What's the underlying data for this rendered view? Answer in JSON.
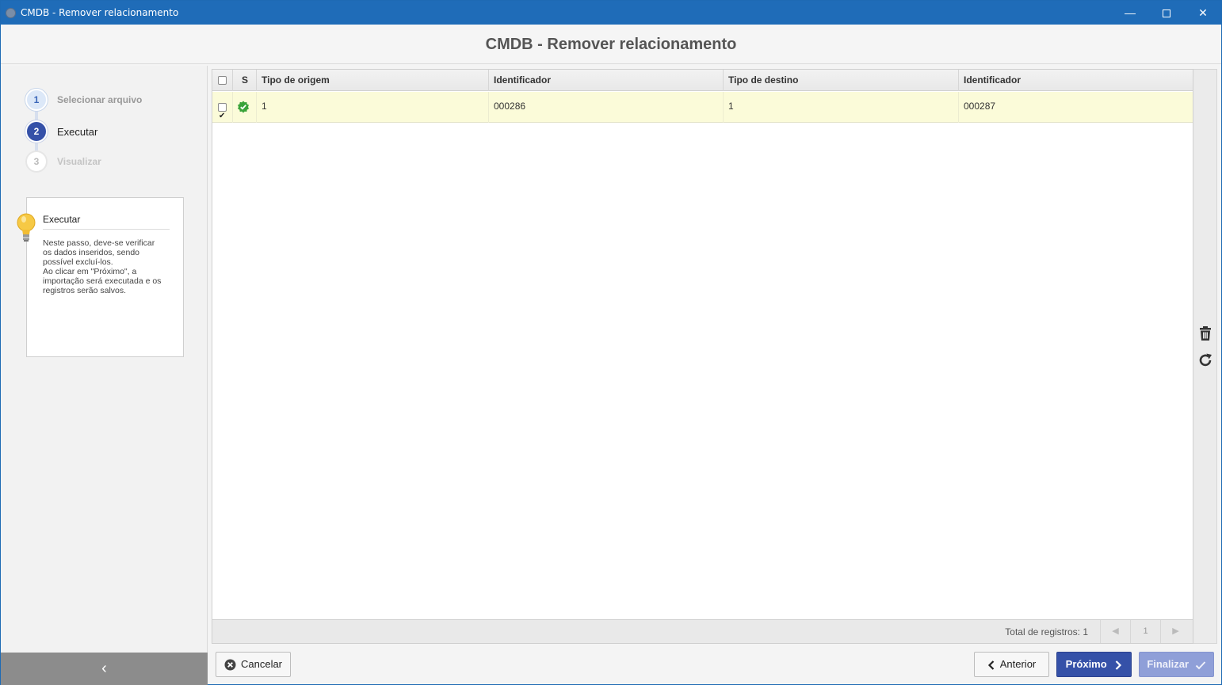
{
  "window": {
    "title": "CMDB - Remover relacionamento",
    "minimize": "—",
    "close": "✕"
  },
  "header": {
    "title": "CMDB - Remover relacionamento"
  },
  "steps": [
    {
      "num": "1",
      "label": "Selecionar arquivo"
    },
    {
      "num": "2",
      "label": "Executar"
    },
    {
      "num": "3",
      "label": "Visualizar"
    }
  ],
  "help": {
    "title": "Executar",
    "text": "Neste passo, deve-se verificar\nos dados inseridos, sendo\npossível excluí-los.\nAo clicar em \"Próximo\", a\nimportação será executada e os\nregistros serão salvos."
  },
  "grid": {
    "columns": [
      "S",
      "Tipo de origem",
      "Identificador",
      "Tipo de destino",
      "Identificador"
    ],
    "rows": [
      {
        "checked": true,
        "status": "ok",
        "tipo_origem": "1",
        "id_origem": "000286",
        "tipo_destino": "1",
        "id_destino": "000287"
      }
    ],
    "total_label": "Total de registros: 1",
    "page": "1",
    "prev_page": "◀",
    "next_page": "▶"
  },
  "buttons": {
    "cancel": "Cancelar",
    "previous": "Anterior",
    "next": "Próximo",
    "finish": "Finalizar"
  },
  "colors": {
    "titlebar": "#1f6cb8",
    "primary": "#3551a8",
    "row_highlight": "#fbfbd9",
    "status_ok": "#3aa33a"
  },
  "collapse_glyph": "‹"
}
